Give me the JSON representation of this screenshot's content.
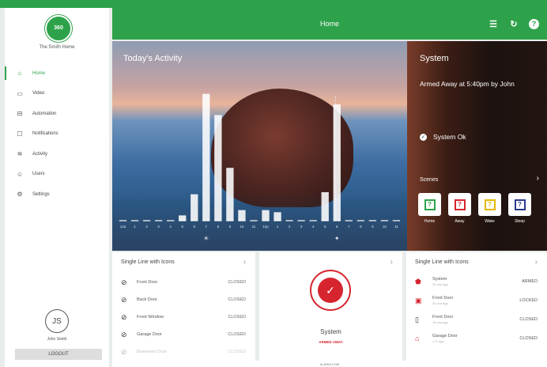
{
  "app": {
    "home_name": "The Smith Home",
    "logo_text": "360"
  },
  "header": {
    "title": "Home"
  },
  "sidebar": {
    "items": [
      {
        "label": "Home",
        "icon": "home-icon"
      },
      {
        "label": "Video",
        "icon": "video-icon"
      },
      {
        "label": "Automation",
        "icon": "automation-icon"
      },
      {
        "label": "Notifications",
        "icon": "notifications-icon"
      },
      {
        "label": "Activity",
        "icon": "activity-icon"
      },
      {
        "label": "Users",
        "icon": "users-icon"
      },
      {
        "label": "Settings",
        "icon": "settings-icon"
      }
    ],
    "user_initials": "JS",
    "user_name": "John Smith",
    "logout_label": "LOGOUT"
  },
  "activity": {
    "title": "Today's Activity",
    "chart_data": {
      "type": "bar",
      "categories": [
        "12a",
        "1",
        "2",
        "3",
        "4",
        "5",
        "6",
        "7",
        "8",
        "9",
        "10",
        "11",
        "12p",
        "1",
        "2",
        "3",
        "4",
        "5",
        "6",
        "7",
        "8",
        "9",
        "10",
        "11"
      ],
      "values": [
        0,
        0,
        0,
        0,
        0,
        0.5,
        2.5,
        12,
        10,
        5,
        1,
        0,
        1,
        0.8,
        0,
        0,
        0,
        2.7,
        11,
        0,
        0,
        0,
        0,
        0
      ],
      "ylim": [
        0,
        14
      ]
    }
  },
  "system": {
    "title": "System",
    "armed_text": "Armed Away at 5:40pm by John",
    "status_text": "System Ok",
    "scenes_label": "Scenes",
    "scenes": [
      {
        "label": "Home",
        "color": "#2ea24a"
      },
      {
        "label": "Away",
        "color": "#d6252f"
      },
      {
        "label": "Wake",
        "color": "#e5b800"
      },
      {
        "label": "Sleep",
        "color": "#2b3a8c"
      }
    ]
  },
  "card_left": {
    "title": "Single Line with Icons",
    "rows": [
      {
        "name": "Front Door",
        "status": "CLOSED"
      },
      {
        "name": "Back Door",
        "status": "CLOSED"
      },
      {
        "name": "Front Window",
        "status": "CLOSED"
      },
      {
        "name": "Garage Door",
        "status": "CLOSED"
      },
      {
        "name": "Basement Door",
        "status": "CLOSED"
      }
    ]
  },
  "card_mid": {
    "title": "System",
    "status": "ARMED AWAY"
  },
  "card_right": {
    "title": "Single Line with Icons",
    "rows": [
      {
        "name": "System",
        "sub": "32 min ago",
        "status": "ARMED"
      },
      {
        "name": "Front Door",
        "sub": "30 min ago",
        "status": "LOCKED"
      },
      {
        "name": "Front Door",
        "sub": "15 min ago",
        "status": "CLOSED"
      },
      {
        "name": "Garage Door",
        "sub": "1 hr ago",
        "status": "CLOSED"
      }
    ]
  },
  "footer": {
    "brand": "ALARM.COM"
  }
}
